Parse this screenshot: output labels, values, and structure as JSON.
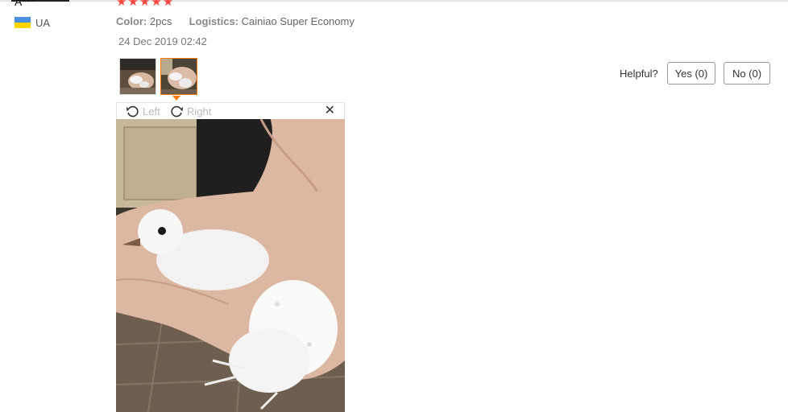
{
  "reviewer": {
    "name": "A***",
    "country": "UA"
  },
  "rating": {
    "stars": 5,
    "star_color": "#f5463f"
  },
  "meta": {
    "color_label": "Color:",
    "color_value": "2pcs",
    "logistics_label": "Logistics:",
    "logistics_value": "Cainiao Super Economy"
  },
  "date": "24 Dec 2019 02:42",
  "thumbnails": [
    {
      "name": "thumb-photo-1",
      "active": false
    },
    {
      "name": "thumb-photo-2",
      "active": true
    }
  ],
  "viewer": {
    "rotate_left": "Left",
    "rotate_right": "Right",
    "close": "✕"
  },
  "helpful": {
    "label": "Helpful?",
    "yes": "Yes (0)",
    "no": "No (0)"
  },
  "colors": {
    "accent": "#ff7a0e",
    "flag_blue": "#4a90e2",
    "flag_yellow": "#ffd500"
  }
}
